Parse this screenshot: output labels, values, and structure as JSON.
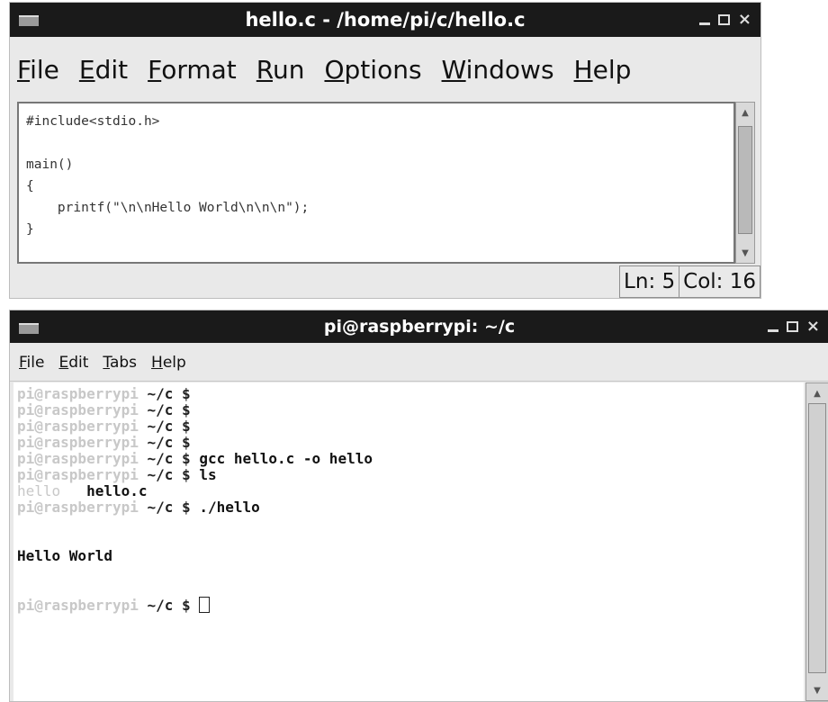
{
  "idle": {
    "title": "hello.c - /home/pi/c/hello.c",
    "menu": [
      "File",
      "Edit",
      "Format",
      "Run",
      "Options",
      "Windows",
      "Help"
    ],
    "code": [
      "#include<stdio.h>",
      "",
      "main()",
      "{",
      "    printf(\"\\n\\nHello World\\n\\n\\n\");",
      "}"
    ],
    "status": {
      "line": "Ln: 5",
      "col": "Col: 16"
    }
  },
  "terminal": {
    "title": "pi@raspberrypi: ~/c",
    "menu": [
      "File",
      "Edit",
      "Tabs",
      "Help"
    ],
    "prompt_user": "pi@raspberrypi",
    "prompt_path": "~/c $",
    "lines": [
      {
        "type": "prompt",
        "cmd": ""
      },
      {
        "type": "prompt",
        "cmd": ""
      },
      {
        "type": "prompt",
        "cmd": ""
      },
      {
        "type": "prompt",
        "cmd": ""
      },
      {
        "type": "prompt",
        "cmd": "gcc hello.c -o hello"
      },
      {
        "type": "prompt",
        "cmd": "ls"
      },
      {
        "type": "ls",
        "items": [
          "hello",
          "hello.c"
        ]
      },
      {
        "type": "prompt",
        "cmd": "./hello"
      },
      {
        "type": "output",
        "text": ""
      },
      {
        "type": "output",
        "text": ""
      },
      {
        "type": "output",
        "text": "Hello World"
      },
      {
        "type": "output",
        "text": ""
      },
      {
        "type": "output",
        "text": ""
      },
      {
        "type": "prompt_cursor",
        "cmd": ""
      }
    ]
  }
}
